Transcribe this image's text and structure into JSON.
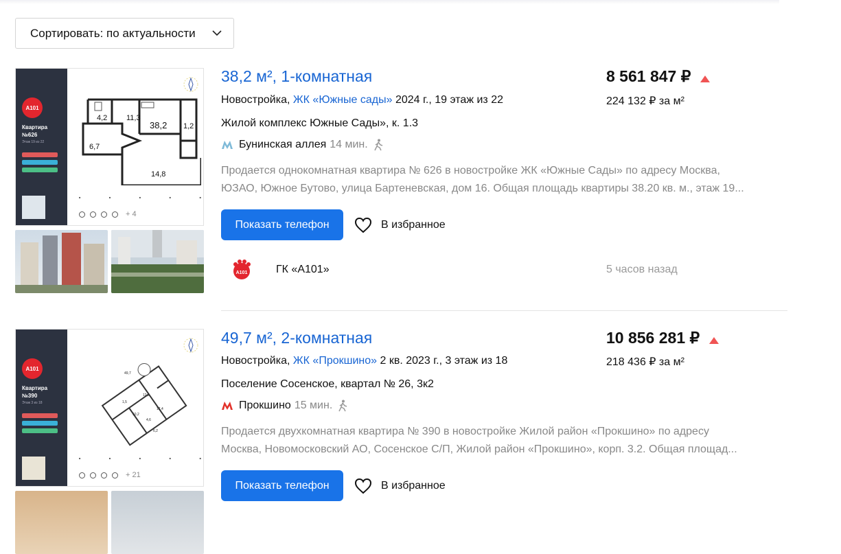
{
  "sort": {
    "label": "Сортировать: по актуальности"
  },
  "listings": [
    {
      "title": "38,2 м², 1-комнатная",
      "type_label": "Новостройка,",
      "complex_link": "ЖК «Южные сады»",
      "year_floor": "2024 г., 19 этаж из 22",
      "address": "Жилой комплекс Южные Сады», к. 1.3",
      "metro_station": "Бунинская аллея",
      "metro_time": "14 мин.",
      "metro_color": "#7fbad8",
      "desc_line1": "Продается однокомнатная квартира № 626 в новостройке ЖК «Южные Сады» по адресу Москва,",
      "desc_line2": "ЮЗАО, Южное Бутово, улица Бартеневская, дом 16. Общая площадь квартиры 38.20 кв. м., этаж 19...",
      "phone_button": "Показать телефон",
      "favorite": "В избранное",
      "price": "8 561 847 ₽",
      "price_per_m2": "224 132 ₽ за м²",
      "developer": "ГК «А101»",
      "posted": "5 часов назад",
      "plan": {
        "logo": "A101",
        "title_line1": "Квартира",
        "title_line2": "№626",
        "subtitle": "Этаж 19 из 22",
        "rooms": [
          "4,2",
          "11,3",
          "38,2",
          "1,2",
          "6,7",
          "14,8"
        ],
        "photos_more": "+ 4"
      }
    },
    {
      "title": "49,7 м², 2-комнатная",
      "type_label": "Новостройка,",
      "complex_link": "ЖК «Прокшино»",
      "year_floor": "2 кв. 2023 г., 3 этаж из 18",
      "address": "Поселение Сосенское, квартал № 26, 3к2",
      "metro_station": "Прокшино",
      "metro_time": "15 мин.",
      "metro_color": "#e2322a",
      "desc_line1": "Продается двухкомнатная квартира № 390 в новостройке Жилой район «Прокшино» по адресу",
      "desc_line2": "Москва, Новомосковский АО, Сосенское С/П, Жилой район «Прокшино», корп. 3.2. Общая площад...",
      "phone_button": "Показать телефон",
      "favorite": "В избранное",
      "price": "10 856 281 ₽",
      "price_per_m2": "218 436 ₽ за м²",
      "plan": {
        "logo": "A101",
        "title_line1": "Квартира",
        "title_line2": "№390",
        "subtitle": "Этаж 3 из 18",
        "rooms": [
          "49,7",
          "12,8",
          "12,4",
          "10,2",
          "4,6",
          "6,2",
          "1,5"
        ],
        "photos_more": "+ 21"
      }
    }
  ]
}
